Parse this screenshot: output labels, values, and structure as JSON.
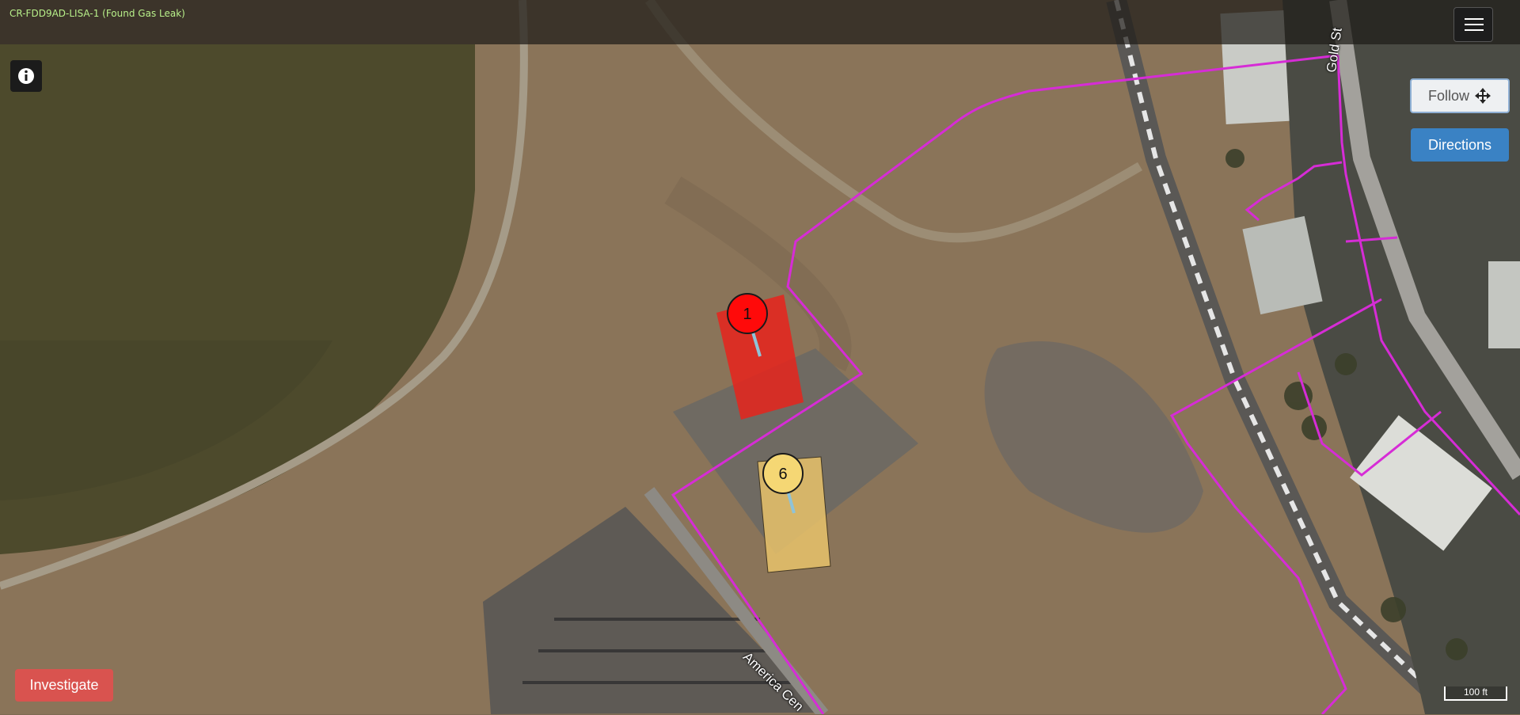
{
  "header": {
    "title": "CR-FDD9AD-LISA-1 (Found Gas Leak)"
  },
  "controls": {
    "follow_label": "Follow",
    "directions_label": "Directions",
    "investigate_label": "Investigate"
  },
  "scale_bar": {
    "label": "100 ft"
  },
  "markers": [
    {
      "number": "1",
      "color": "#ff0a0a"
    },
    {
      "number": "6",
      "color": "#f5d774"
    }
  ],
  "streets": [
    "Gold St",
    "America Cen"
  ],
  "colors": {
    "boundary": "#d62cd6",
    "leak_area_red": "#e8231c",
    "leak_area_yellow": "#e9c36b",
    "info_button": "#1b1b1b",
    "directions_button": "#3a82c4",
    "investigate_button": "#d9534f"
  },
  "icons": [
    "hamburger-menu-icon",
    "info-icon",
    "move-arrows-icon"
  ]
}
